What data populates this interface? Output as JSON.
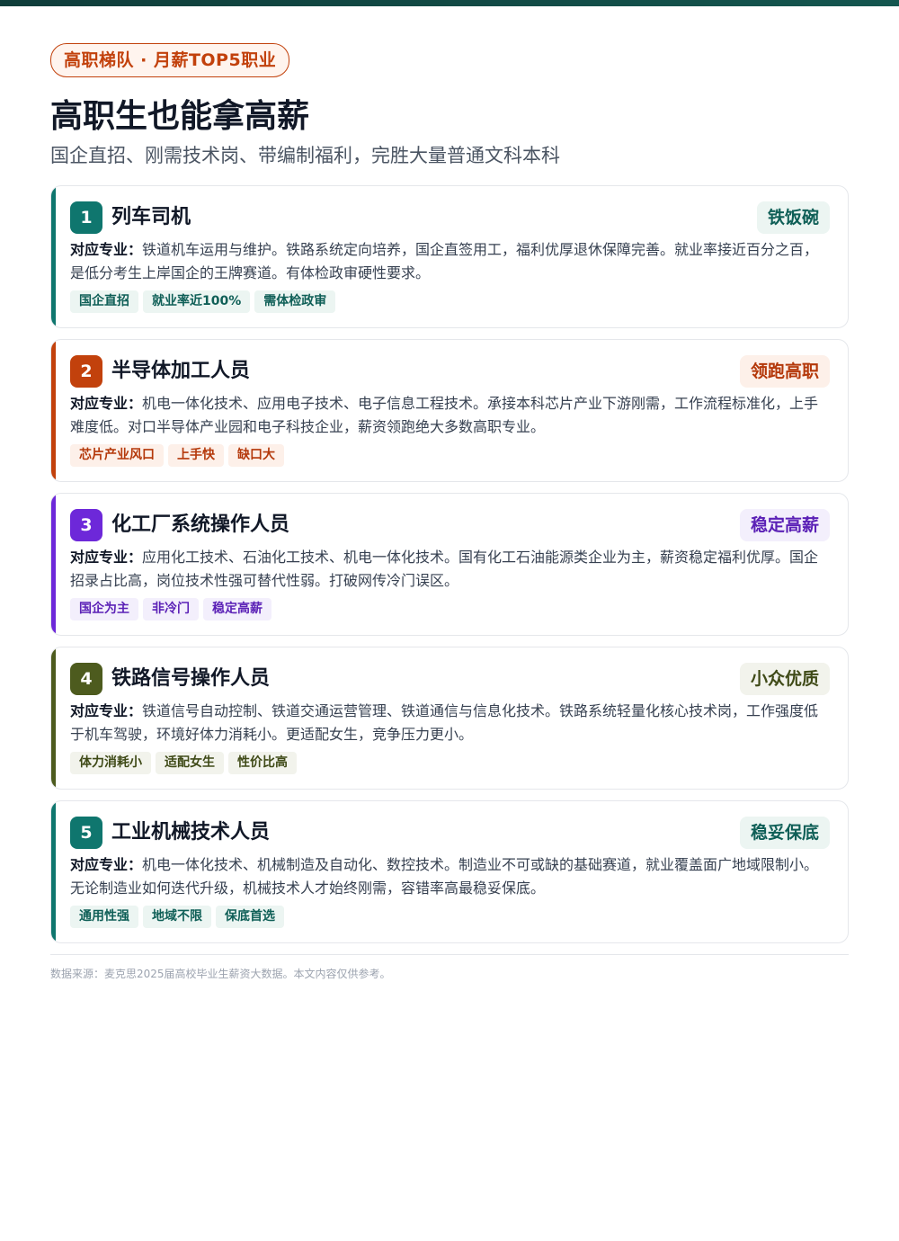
{
  "header": {
    "pill": "高职梯队 · 月薪TOP5职业",
    "title": "高职生也能拿高薪",
    "subtitle": "国企直招、刚需技术岗、带编制福利，完胜大量普通文科本科"
  },
  "desc_label": "对应专业：",
  "cards": [
    {
      "rank": "1",
      "job": "列车司机",
      "tag": "铁饭碗",
      "desc": "铁道机车运用与维护。铁路系统定向培养，国企直签用工，福利优厚退休保障完善。就业率接近百分之百，是低分考生上岸国企的王牌赛道。有体检政审硬性要求。",
      "chips": [
        "国企直招",
        "就业率近100%",
        "需体检政审"
      ]
    },
    {
      "rank": "2",
      "job": "半导体加工人员",
      "tag": "领跑高职",
      "desc": "机电一体化技术、应用电子技术、电子信息工程技术。承接本科芯片产业下游刚需，工作流程标准化，上手难度低。对口半导体产业园和电子科技企业，薪资领跑绝大多数高职专业。",
      "chips": [
        "芯片产业风口",
        "上手快",
        "缺口大"
      ]
    },
    {
      "rank": "3",
      "job": "化工厂系统操作人员",
      "tag": "稳定高薪",
      "desc": "应用化工技术、石油化工技术、机电一体化技术。国有化工石油能源类企业为主，薪资稳定福利优厚。国企招录占比高，岗位技术性强可替代性弱。打破网传冷门误区。",
      "chips": [
        "国企为主",
        "非冷门",
        "稳定高薪"
      ]
    },
    {
      "rank": "4",
      "job": "铁路信号操作人员",
      "tag": "小众优质",
      "desc": "铁道信号自动控制、铁道交通运营管理、铁道通信与信息化技术。铁路系统轻量化核心技术岗，工作强度低于机车驾驶，环境好体力消耗小。更适配女生，竞争压力更小。",
      "chips": [
        "体力消耗小",
        "适配女生",
        "性价比高"
      ]
    },
    {
      "rank": "5",
      "job": "工业机械技术人员",
      "tag": "稳妥保底",
      "desc": "机电一体化技术、机械制造及自动化、数控技术。制造业不可或缺的基础赛道，就业覆盖面广地域限制小。无论制造业如何迭代升级，机械技术人才始终刚需，容错率高最稳妥保底。",
      "chips": [
        "通用性强",
        "地域不限",
        "保底首选"
      ]
    }
  ],
  "footer": {
    "source": "数据来源：麦克思2025届高校毕业生薪资大数据。本文内容仅供参考。"
  }
}
